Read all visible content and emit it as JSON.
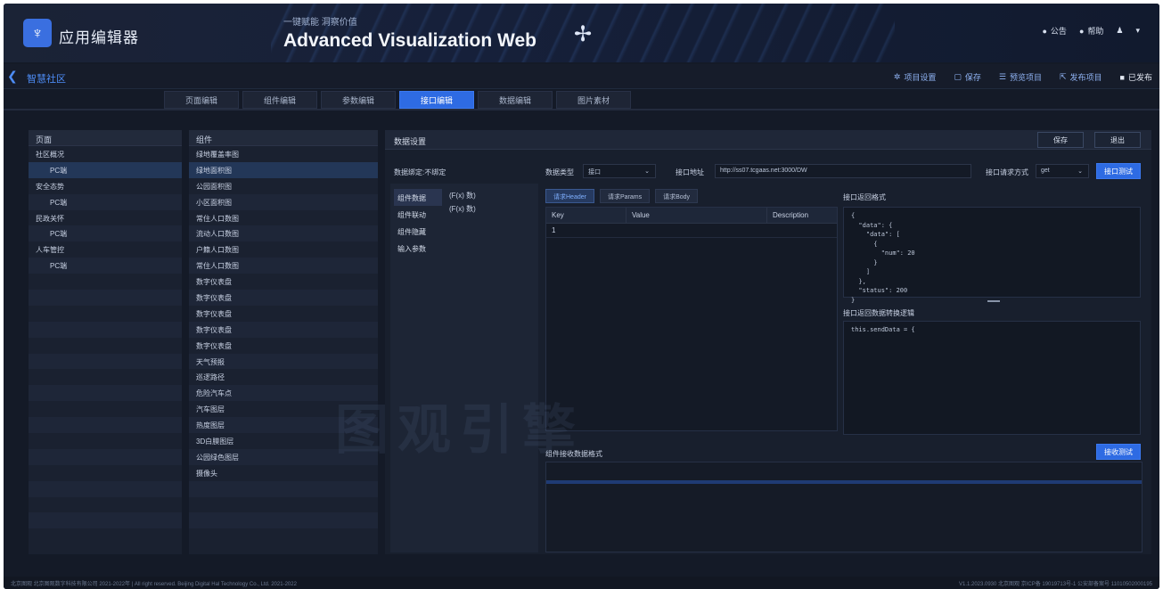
{
  "header": {
    "app_name": "应用编辑器",
    "slogan": "一键赋能 洞察价值",
    "title": "Advanced Visualization Web",
    "right": {
      "a": "公告",
      "b": "帮助",
      "c": "▾"
    }
  },
  "subbar": {
    "crumb": "智慧社区",
    "actions": [
      "项目设置",
      "保存",
      "预览项目",
      "发布项目",
      "已发布"
    ]
  },
  "tabs": [
    "页面编辑",
    "组件编辑",
    "参数编辑",
    "接口编辑",
    "数据编辑",
    "图片素材"
  ],
  "left": {
    "header": "页面",
    "tree": [
      {
        "label": "社区概况",
        "child": false
      },
      {
        "label": "PC端",
        "child": true,
        "sel": true
      },
      {
        "label": "安全态势",
        "child": false
      },
      {
        "label": "PC端",
        "child": true
      },
      {
        "label": "民政关怀",
        "child": false
      },
      {
        "label": "PC端",
        "child": true
      },
      {
        "label": "人车管控",
        "child": false
      },
      {
        "label": "PC端",
        "child": true
      }
    ]
  },
  "middle": {
    "header": "组件",
    "items": [
      "绿地覆盖率图",
      "绿地面积图",
      "公园面积图",
      "小区面积图",
      "常住人口数图",
      "流动人口数图",
      "户籍人口数图",
      "常住人口数图",
      "数字仪表盘",
      "数字仪表盘",
      "数字仪表盘",
      "数字仪表盘",
      "数字仪表盘",
      "天气预报",
      "巡逻路径",
      "危险汽车点",
      "汽车图层",
      "热度图层",
      "3D白膜图层",
      "公园绿色图层",
      "摄像头"
    ]
  },
  "config": {
    "title": "数据设置",
    "btn_reset": "保存",
    "btn_cancel": "退出",
    "current": "数据绑定:不绑定",
    "source_label": "数据类型",
    "source_value": "接口",
    "url_label": "接口地址",
    "url_value": "http://ss07.tcgaas.net:3000/DW",
    "method_label": "接口请求方式",
    "method_value": "get",
    "test_btn": "接口测试",
    "side_menu": [
      "组件数据",
      "组件联动",
      "组件隐藏",
      "输入参数"
    ],
    "side_items": [
      "(F(x) 数)",
      "(F(x) 数)"
    ],
    "ptabs": [
      "请求Header",
      "请求Params",
      "请求Body"
    ],
    "table_headers": [
      "Key",
      "Value",
      "Description"
    ],
    "table_first": "1",
    "response_label": "接口返回格式",
    "response_code": "{\n  \"data\": {\n    \"data\": [\n      {\n        \"num\": 20\n      }\n    ]\n  },\n  \"status\": 200\n}",
    "logic_label": "接口返回数据转换逻辑",
    "logic_code": "this.sendData = {",
    "bottom_label": "组件接收数据格式",
    "bottom_btn": "接收测试"
  },
  "watermark": "图观引擎",
  "footer": {
    "left": "北京图观 北京图观数字科技有限公司 2021-2022年 | All right reserved. Beijing Digital Hal Technology Co., Ltd. 2021-2022",
    "right": "V1.1.2023.0930 北京图观 京ICP备 19019713号-1 公安部备案号 11010502000195"
  }
}
